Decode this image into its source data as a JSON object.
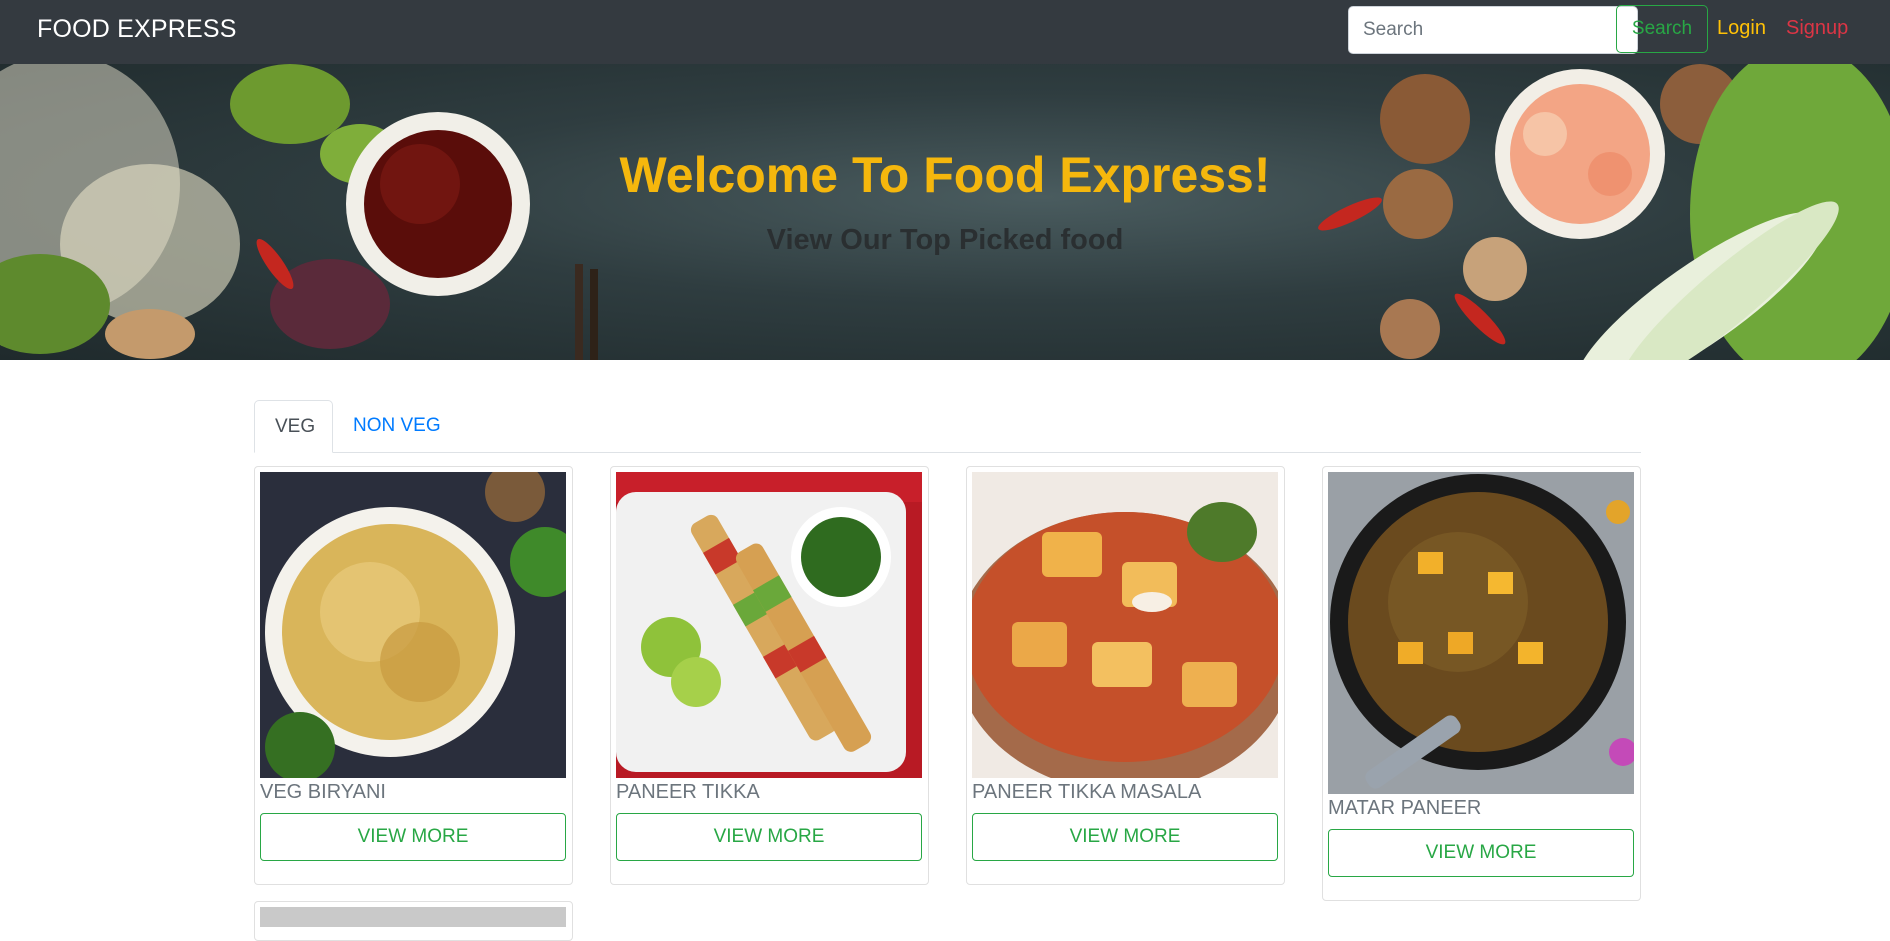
{
  "navbar": {
    "brand": "FOOD EXPRESS",
    "search_placeholder": "Search",
    "search_button": "Search",
    "login": "Login",
    "signup": "Signup"
  },
  "hero": {
    "title": "Welcome To Food Express!",
    "subtitle": "View Our Top Picked food"
  },
  "tabs": [
    {
      "label": "VEG",
      "active": true
    },
    {
      "label": "NON VEG",
      "active": false
    }
  ],
  "cards": [
    {
      "name": "VEG BIRYANI",
      "button": "VIEW MORE"
    },
    {
      "name": "PANEER TIKKA",
      "button": "VIEW MORE"
    },
    {
      "name": "PANEER TIKKA MASALA",
      "button": "VIEW MORE"
    },
    {
      "name": "MATAR PANEER",
      "button": "VIEW MORE"
    }
  ],
  "colors": {
    "navbar_bg": "#343a40",
    "accent_green": "#28a745",
    "login_yellow": "#ffc107",
    "signup_red": "#dc3545",
    "hero_title": "#f5b70d",
    "tab_link_blue": "#007bff"
  }
}
